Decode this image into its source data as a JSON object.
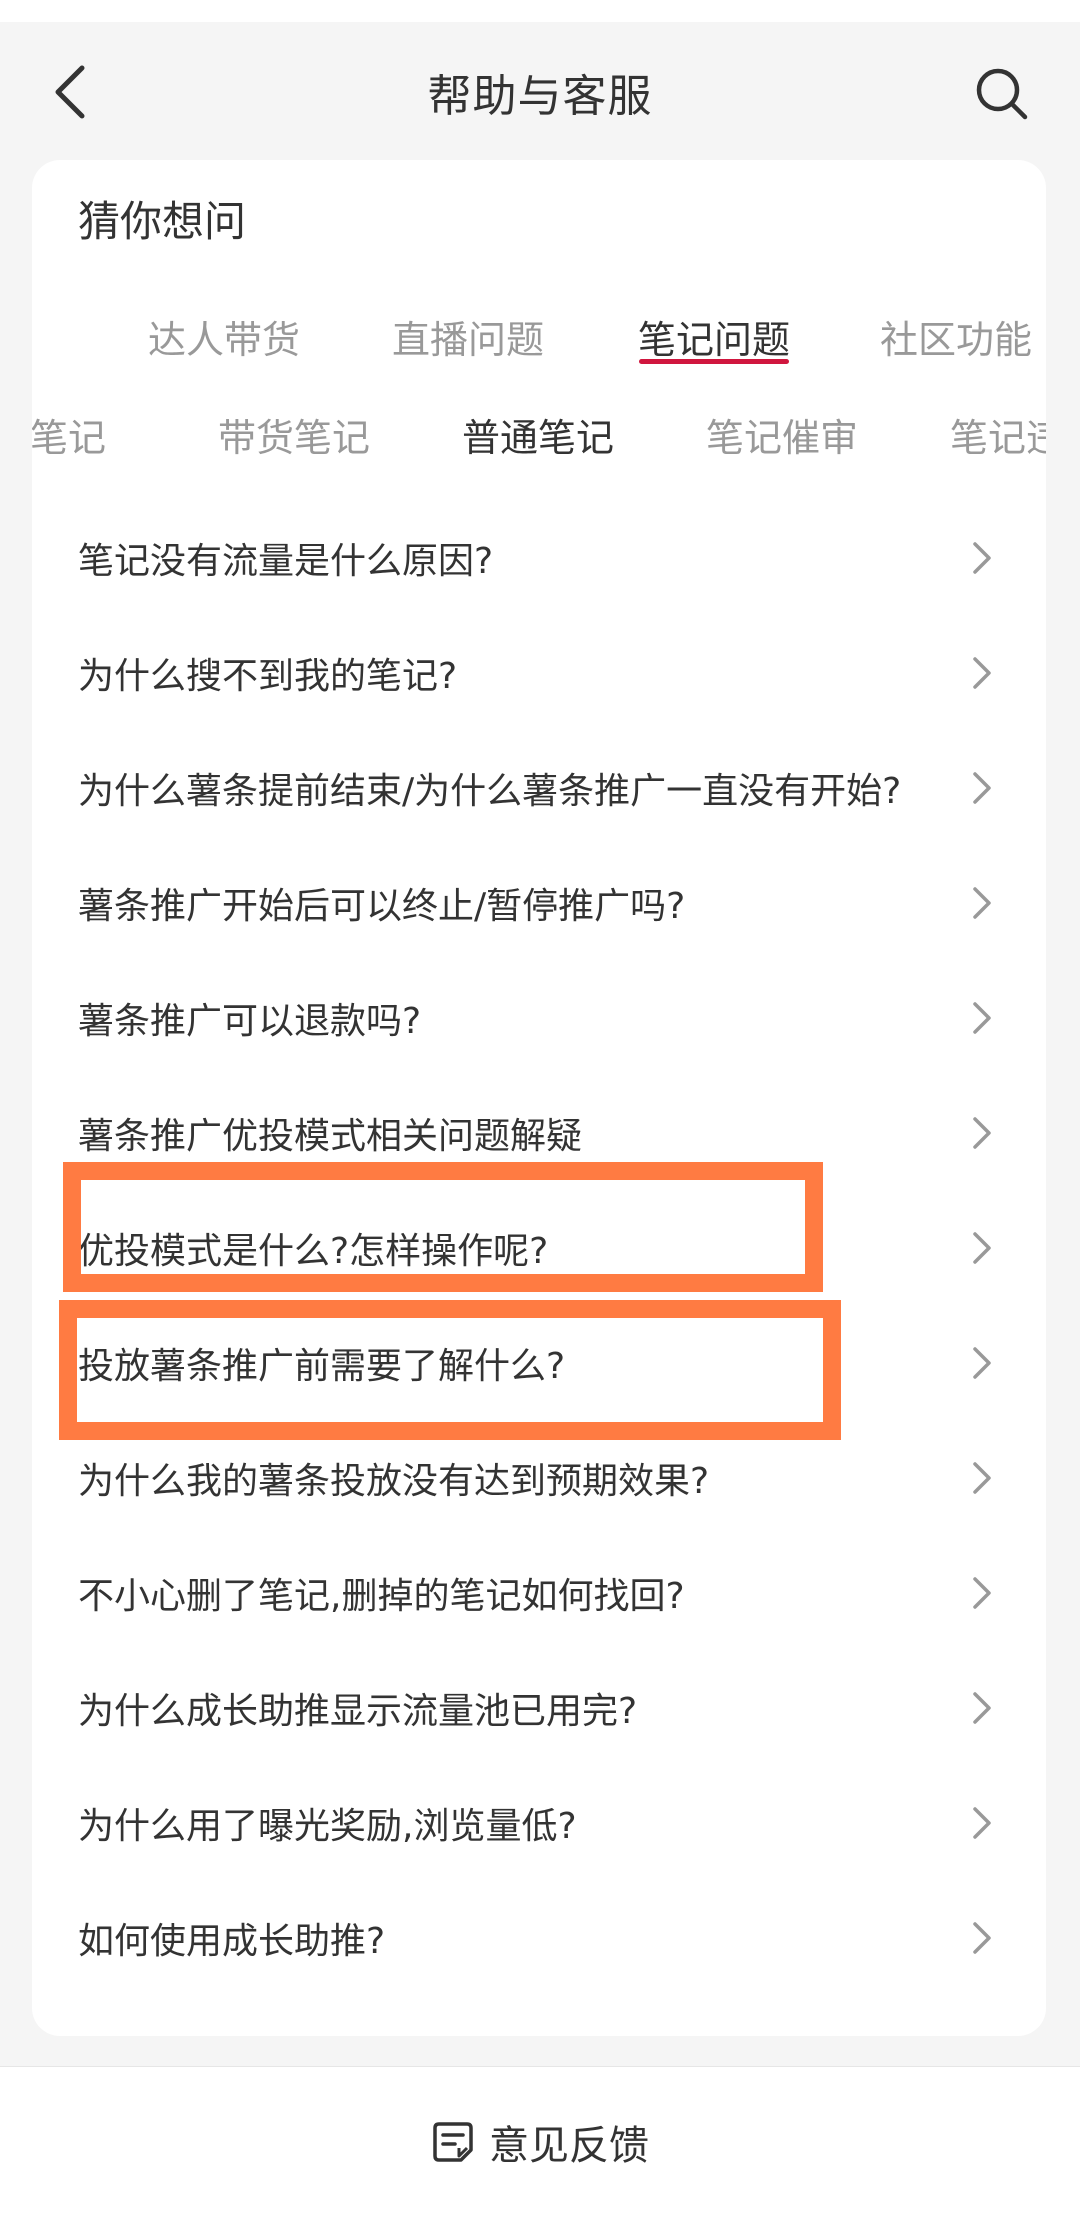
{
  "header": {
    "title": "帮助与客服",
    "back_icon": "chevron-left-icon",
    "search_icon": "search-icon"
  },
  "guess": {
    "title": "猜你想问"
  },
  "tabs": [
    {
      "label": "达人带货",
      "active": false
    },
    {
      "label": "直播问题",
      "active": false
    },
    {
      "label": "笔记问题",
      "active": true
    },
    {
      "label": "社区功能",
      "active": false
    }
  ],
  "subtabs": [
    {
      "label": "品笔记",
      "active": false
    },
    {
      "label": "带货笔记",
      "active": false
    },
    {
      "label": "普通笔记",
      "active": true
    },
    {
      "label": "笔记催审",
      "active": false
    },
    {
      "label": "笔记违",
      "active": false
    }
  ],
  "questions": [
    "笔记没有流量是什么原因?",
    "为什么搜不到我的笔记?",
    "为什么薯条提前结束/为什么薯条推广一直没有开始?",
    "薯条推广开始后可以终止/暂停推广吗?",
    "薯条推广可以退款吗?",
    "薯条推广优投模式相关问题解疑",
    "优投模式是什么?怎样操作呢?",
    "投放薯条推广前需要了解什么?",
    "为什么我的薯条投放没有达到预期效果?",
    "不小心删了笔记,删掉的笔记如何找回?",
    "为什么成长助推显示流量池已用完?",
    "为什么用了曝光奖励,浏览量低?",
    "如何使用成长助推?"
  ],
  "footer": {
    "feedback_label": "意见反馈",
    "feedback_icon": "feedback-icon"
  },
  "colors": {
    "accent_underline": "#d0163e",
    "highlight_box": "#ff7b42"
  }
}
